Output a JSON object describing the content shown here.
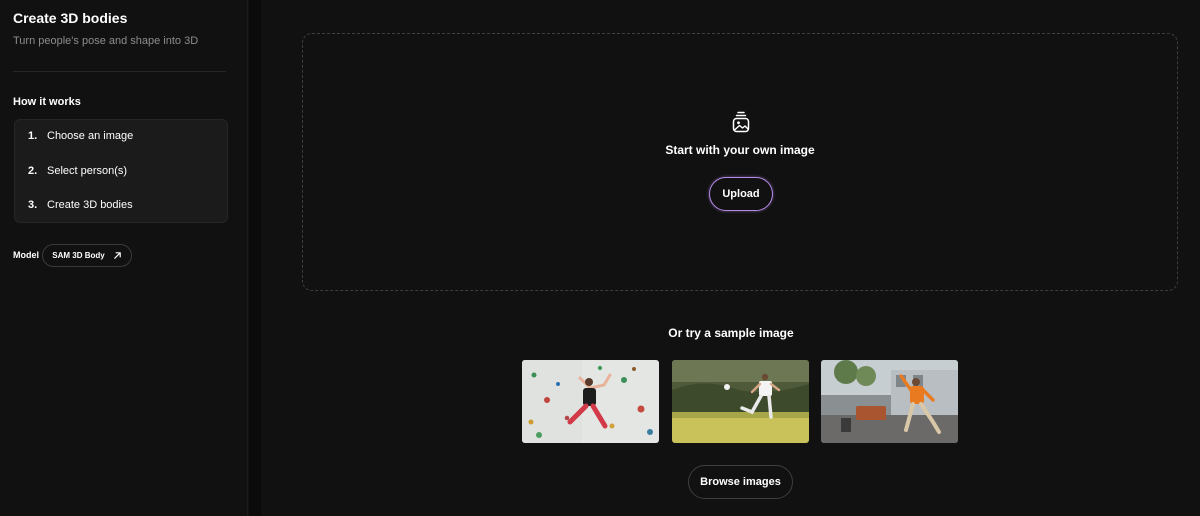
{
  "sidebar": {
    "title": "Create 3D bodies",
    "subtitle": "Turn people's pose and shape into 3D",
    "how_heading": "How it works",
    "steps": [
      {
        "num": "1.",
        "label": "Choose an image"
      },
      {
        "num": "2.",
        "label": "Select person(s)"
      },
      {
        "num": "3.",
        "label": "Create 3D bodies"
      }
    ],
    "model_label": "Model",
    "model_name": "SAM 3D Body",
    "model_icon": "arrow-up-right-icon"
  },
  "main": {
    "upload_icon": "image-upload-icon",
    "upload_title": "Start with your own image",
    "upload_button": "Upload",
    "sample_heading": "Or try a sample image",
    "samples": [
      {
        "icon": "climber-photo"
      },
      {
        "icon": "soccer-kick-photo"
      },
      {
        "icon": "street-dancer-photo"
      }
    ],
    "browse_button": "Browse images"
  },
  "colors": {
    "background": "#111111",
    "panel": "#1b1b1b",
    "upload_border": "#b58be6",
    "muted_text": "#8d8d8d"
  }
}
